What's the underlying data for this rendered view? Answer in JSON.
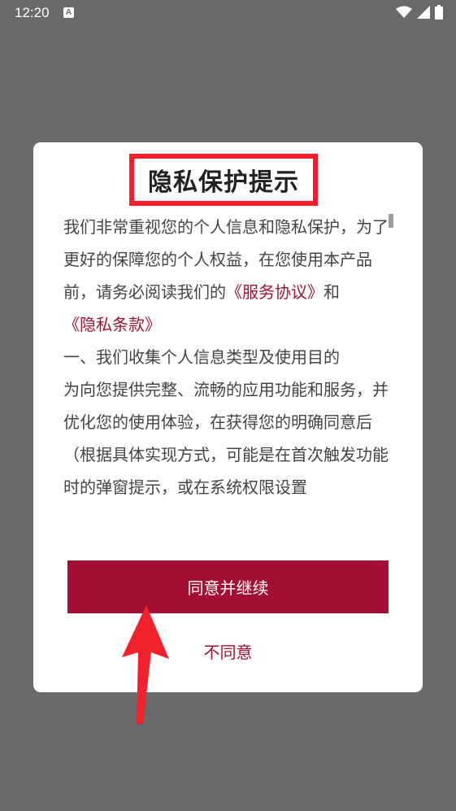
{
  "status_bar": {
    "time": "12:20",
    "notification_icon": "A",
    "icons": [
      "wifi-icon",
      "signal-icon",
      "battery-icon"
    ]
  },
  "dialog": {
    "title": "隐私保护提示",
    "paragraph_1": {
      "text_before": "我们非常重视您的个人信息和隐私保护，为了更好的保障您的个人权益，在您使用本产品前，请务必阅读我们的",
      "service_link": "《服务协议》",
      "and_text": "和",
      "privacy_link": "《隐私条款》"
    },
    "section_heading": "一、我们收集个人信息类型及使用目的",
    "paragraph_2": " 为向您提供完整、流畅的应用功能和服务，并优化您的使用体验，在获得您的明确同意后（根据具体实现方式，可能是在首次触发功能时的弹窗提示，或在系统权限设置",
    "agree_label": "同意并继续",
    "disagree_label": "不同意"
  },
  "colors": {
    "accent": "#a50e33",
    "highlight_box": "#ff1a2a",
    "overlay": "#6a6a6a"
  }
}
